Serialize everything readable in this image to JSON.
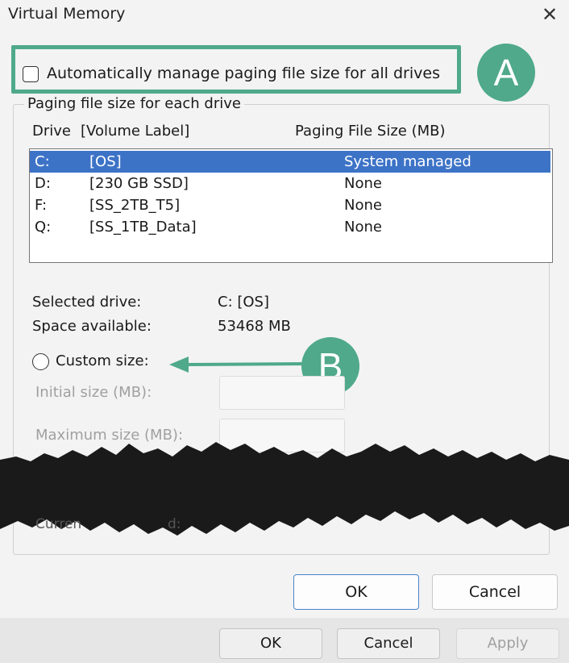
{
  "window": {
    "title": "Virtual Memory",
    "close_glyph": "✕"
  },
  "auto_manage": {
    "label": "Automatically manage paging file size for all drives",
    "checked": false
  },
  "annotations": {
    "a": "A",
    "b": "B"
  },
  "group": {
    "legend": "Paging file size for each drive",
    "headers": {
      "drive": "Drive",
      "volume": "[Volume Label]",
      "size": "Paging File Size (MB)"
    },
    "rows": [
      {
        "drive": "C:",
        "label": "[OS]",
        "size": "System managed"
      },
      {
        "drive": "D:",
        "label": "[230 GB SSD]",
        "size": "None"
      },
      {
        "drive": "F:",
        "label": "[SS_2TB_T5]",
        "size": "None"
      },
      {
        "drive": "Q:",
        "label": "[SS_1TB_Data]",
        "size": "None"
      }
    ],
    "selected_drive_label": "Selected drive:",
    "selected_drive_value": "C:  [OS]",
    "space_label": "Space available:",
    "space_value": "53468 MB",
    "custom_size_label": "Custom size:",
    "initial_label": "Initial size (MB):",
    "maximum_label": "Maximum size (MB):",
    "partial_label_left": "Curren",
    "partial_label_right": "d:"
  },
  "buttons": {
    "ok": "OK",
    "cancel": "Cancel"
  },
  "bottom": {
    "ok": "OK",
    "cancel": "Cancel",
    "apply": "Apply"
  },
  "colors": {
    "accent_green": "#4fa98a",
    "selection_blue": "#3d73c7"
  }
}
